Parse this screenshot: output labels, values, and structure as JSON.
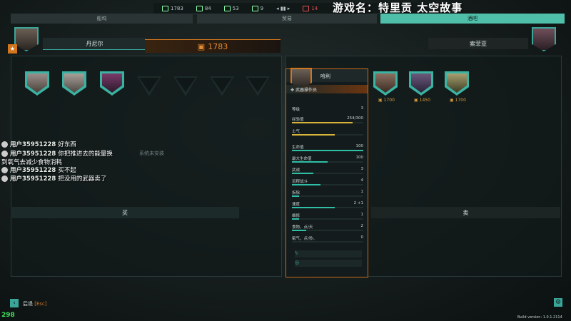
{
  "resources": [
    {
      "icon": "scrap-icon",
      "value": "1783"
    },
    {
      "icon": "fuel-icon",
      "value": "84"
    },
    {
      "icon": "missile-icon",
      "value": "53"
    },
    {
      "icon": "drone-icon",
      "value": "9"
    },
    {
      "icon": "hull-icon",
      "value": "14",
      "alert": true
    }
  ],
  "stream_title": "游戏名：特里贡 太空故事",
  "tabs": [
    {
      "label": "船坞"
    },
    {
      "label": "贸易"
    },
    {
      "label": "酒吧"
    }
  ],
  "player": {
    "name": "丹尼尔",
    "scrap": "1783"
  },
  "vendor": {
    "name": "索菲亚"
  },
  "left_panel": {
    "empty_text": "系统未安装",
    "buy_label": "买"
  },
  "right_panel": {
    "sell_label": "卖"
  },
  "vendor_crew": [
    {
      "price": "1700"
    },
    {
      "price": "1450"
    },
    {
      "price": "1700"
    }
  ],
  "card": {
    "name": "哈利",
    "role": "武器操作员",
    "stats": [
      {
        "label": "等级",
        "value": "3"
      },
      {
        "label": "经验值",
        "value": "254/300",
        "fill": 0.85,
        "color": "yellow"
      },
      {
        "label": "士气",
        "value": "",
        "fill": 0.6,
        "color": "yellow"
      },
      {
        "label": "生命值",
        "value": "100",
        "fill": 1.0
      },
      {
        "label": "最大生命值",
        "value": "100",
        "fill": 0.5
      },
      {
        "label": "武战",
        "value": "3",
        "fill": 0.3
      },
      {
        "label": "远程战斗",
        "value": "4",
        "fill": 0.4
      },
      {
        "label": "拆除",
        "value": "1",
        "fill": 0.1
      },
      {
        "label": "速度",
        "value": "2 +1",
        "fill": 0.6
      },
      {
        "label": "维修",
        "value": "1",
        "fill": 0.1
      },
      {
        "label": "食物，点/天",
        "value": "2",
        "fill": 0.2
      },
      {
        "label": "氧气，点/秒。",
        "value": "0",
        "fill": 0.0
      }
    ]
  },
  "chat": [
    {
      "user": "用户35951228",
      "msg": "好东西"
    },
    {
      "user": "用户35951228",
      "msg": "你把推进去的能量换"
    },
    {
      "user": "",
      "msg": "到氧气去减少食物消耗"
    },
    {
      "user": "用户35951228",
      "msg": "买不起"
    },
    {
      "user": "用户35951228",
      "msg": "把没用的武器卖了"
    }
  ],
  "back": {
    "label": "后退",
    "key": "[Esc]"
  },
  "fps": "298",
  "build": "Build version: 1.0.1.2114",
  "colors": {
    "accent": "#3aa69a",
    "orange": "#d2761e",
    "bg": "#161d1d"
  }
}
